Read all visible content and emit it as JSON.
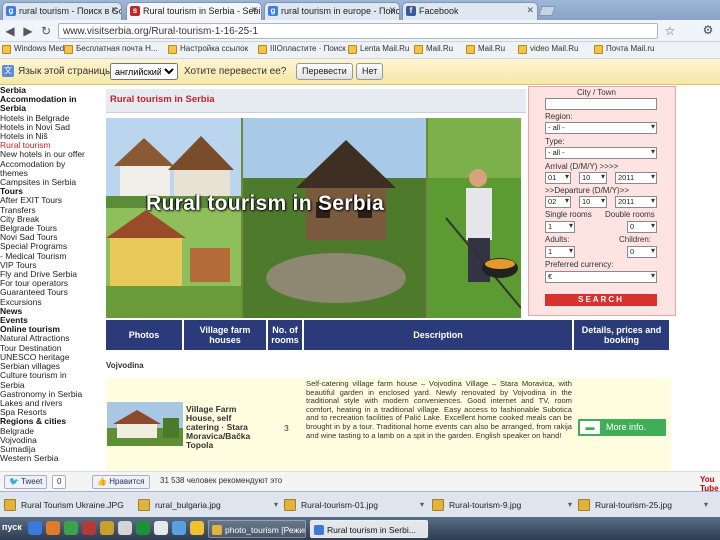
{
  "browser": {
    "tabs": [
      {
        "label": "rural tourism - Поиск в Google",
        "icon": "google-favicon",
        "color": "#3d7be0",
        "glyph": "g"
      },
      {
        "label": "Rural tourism in Serbia - Sebi",
        "icon": "page-favicon",
        "color": "#c0262b",
        "glyph": "s"
      },
      {
        "label": "rural tourism in europe - Поис",
        "icon": "google-favicon",
        "color": "#3d7be0",
        "glyph": "g"
      },
      {
        "label": "Facebook",
        "icon": "facebook-favicon",
        "color": "#3b5998",
        "glyph": "f"
      }
    ],
    "url": "www.visitserbia.org/Rural-tourism-1-16-25-1",
    "bookmarks": [
      "Windows Media",
      "Бесплатная почта H...",
      "Настройка ссылок",
      "IIIОпластите · Поиск",
      "Lenta Mail.Ru",
      "Mail.Ru",
      "Mail.Ru",
      "video Mail.Ru",
      "Почта Mail.ru"
    ]
  },
  "translate_bar": {
    "prompt": "Язык этой страницы",
    "language": "английский",
    "question": "Хотите перевести ее?",
    "translate_label": "Перевести",
    "no_label": "Нет"
  },
  "nav": {
    "items": [
      {
        "label": "Serbia",
        "kind": "head"
      },
      {
        "label": "Accommodation in",
        "kind": "head"
      },
      {
        "label": "Serbia",
        "kind": "head"
      },
      {
        "label": "Hotels in Belgrade",
        "kind": "item"
      },
      {
        "label": "Hotels in Novi Sad",
        "kind": "item"
      },
      {
        "label": "Hotels in Niš",
        "kind": "item"
      },
      {
        "label": "Rural tourism",
        "kind": "hl"
      },
      {
        "label": "New hotels in our offer",
        "kind": "item"
      },
      {
        "label": "Accomodation by",
        "kind": "item"
      },
      {
        "label": "themes",
        "kind": "item"
      },
      {
        "label": "Campsites in Serbia",
        "kind": "item"
      },
      {
        "label": "Tours",
        "kind": "head"
      },
      {
        "label": "After EXIT Tours",
        "kind": "item"
      },
      {
        "label": "Transfers",
        "kind": "item"
      },
      {
        "label": "City Break",
        "kind": "item"
      },
      {
        "label": "Belgrade Tours",
        "kind": "item"
      },
      {
        "label": "Novi Sad Tours",
        "kind": "item"
      },
      {
        "label": "Special Programs",
        "kind": "item"
      },
      {
        "label": "- Medical Tourism",
        "kind": "item"
      },
      {
        "label": "VIP Tours",
        "kind": "item"
      },
      {
        "label": "Fly and Drive Serbia",
        "kind": "item"
      },
      {
        "label": "For tour operators",
        "kind": "item"
      },
      {
        "label": "Guaranteed Tours",
        "kind": "item"
      },
      {
        "label": "Excursions",
        "kind": "item"
      },
      {
        "label": "News",
        "kind": "head"
      },
      {
        "label": "Events",
        "kind": "head"
      },
      {
        "label": "Online tourism",
        "kind": "head"
      },
      {
        "label": "Natural Attractions",
        "kind": "item"
      },
      {
        "label": "Tour Destination",
        "kind": "item"
      },
      {
        "label": "UNESCO heritage",
        "kind": "item"
      },
      {
        "label": "Serbian villages",
        "kind": "item"
      },
      {
        "label": "Culture tourism in",
        "kind": "item"
      },
      {
        "label": "Serbia",
        "kind": "item"
      },
      {
        "label": "Gastronomy in Serbia",
        "kind": "item"
      },
      {
        "label": "Lakes and rivers",
        "kind": "item"
      },
      {
        "label": "Spa Resorts",
        "kind": "item"
      },
      {
        "label": "Regions & cities",
        "kind": "head"
      },
      {
        "label": "Belgrade",
        "kind": "item"
      },
      {
        "label": "Vojvodina",
        "kind": "item"
      },
      {
        "label": "Sumadija",
        "kind": "item"
      },
      {
        "label": "Western Serbia",
        "kind": "item"
      }
    ]
  },
  "main": {
    "title": "Rural tourism in Serbia",
    "hero_title": "Rural tourism in Serbia"
  },
  "search": {
    "city_label": "City / Town",
    "city_value": "",
    "region_label": "Region:",
    "region_value": "- all -",
    "type_label": "Type:",
    "type_value": "- all -",
    "arrival_label": "Arrival (D/M/Y) >>>>",
    "arrival": [
      "01",
      "10",
      "2011"
    ],
    "departure_label": ">>Departure (D/M/Y)>>",
    "departure": [
      "02",
      "10",
      "2011"
    ],
    "single_label": "Single rooms",
    "double_label": "Double rooms",
    "single_value": "1",
    "double_value": "0",
    "adults_label": "Adults:",
    "children_label": "Children:",
    "adults_value": "1",
    "children_value": "0",
    "currency_label": "Preferred currency:",
    "currency_value": "€",
    "button_label": "SEARCH"
  },
  "table": {
    "headers": [
      "Photos",
      "Village farm houses",
      "No. of rooms",
      "Description",
      "Details, prices and booking"
    ],
    "region": "Vojvodina",
    "rows": [
      {
        "name": "Village Farm House, self catering · Stara Moravica/Bačka Topola",
        "rooms": "3",
        "description": "Self-catering village farm house – Vojvodina Village – Stara Moravica, with beautiful garden in enclosed yard. Newly renovated by Vojvodina in the traditional style with modern conveniences. Good internet and TV, room comfort, heating in a traditional village. Easy access to fashionable Subotica and to recreation facilities of Palić Lake. Excellent home cooked meals can be brought in by a tour. Traditional home events can also be arranged, from rakija and wine tasting to a lamb on a spit in the garden. English speaker on hand!",
        "button": "More info."
      }
    ]
  },
  "social": {
    "tweet": "Tweet",
    "count": "0",
    "like": "Нравится",
    "recommend": "31 538 человек рекомендуют это",
    "yt": "You Tube"
  },
  "downloads": [
    "Rural Tourism Ukraine.JPG",
    "rural_bulgaria.jpg",
    "Rural-tourism-01.jpg",
    "Rural-tourism-9.jpg",
    "Rural-tourism-25.jpg"
  ],
  "taskbar": {
    "start": "пуск",
    "items": [
      "",
      "",
      "",
      "",
      "photo_tourism [Режим о...",
      "Rural tourism in Serbi..."
    ]
  },
  "colors": {
    "accent_red": "#c0262b",
    "header_navy": "#2b3b7a",
    "button_green": "#3fae57",
    "search_bg": "#fde3e1"
  }
}
